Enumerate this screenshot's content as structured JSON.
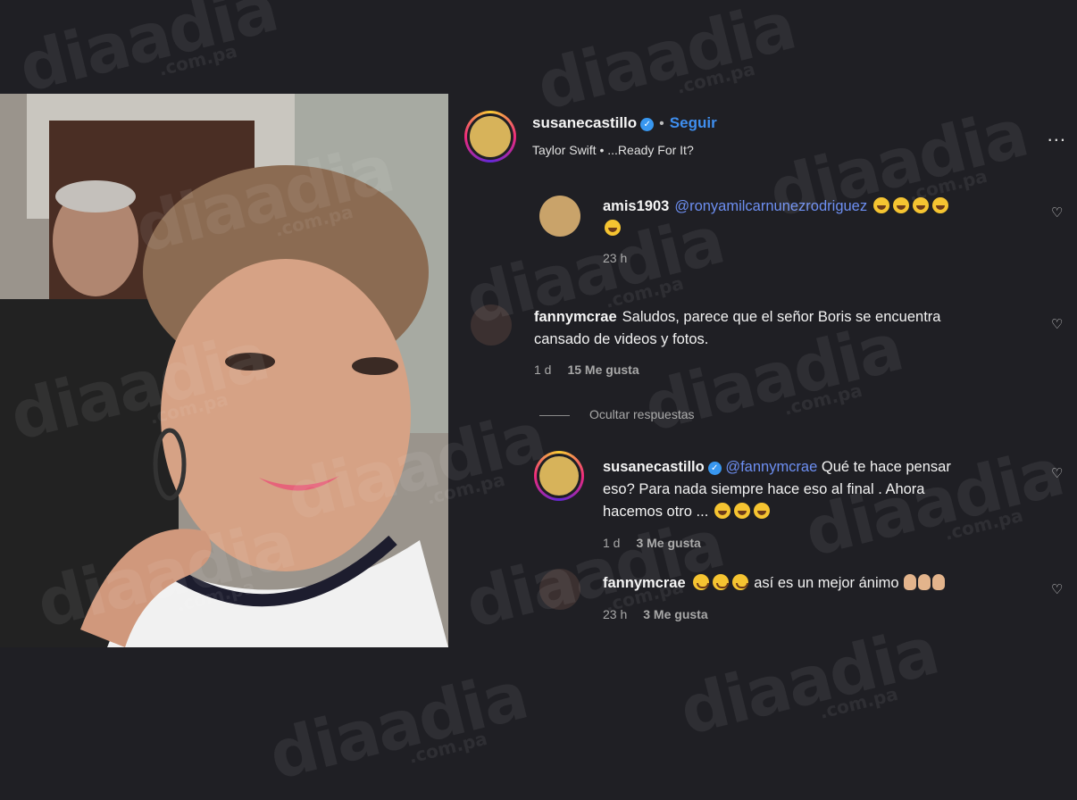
{
  "post": {
    "username": "susanecastillo",
    "verified": "✓",
    "separator": "•",
    "follow_label": "Seguir",
    "song": "Taylor Swift • ...Ready For It?",
    "more_label": "..."
  },
  "comments": [
    {
      "user": "amis1903",
      "mention": "@ronyamilcarnunezrodriguez",
      "text": "",
      "time": "23 h",
      "likes": ""
    },
    {
      "user": "fannymcrae",
      "mention": "",
      "text_line1": "Saludos, parece que el señor Boris se encuentra",
      "text_line2": "cansado de videos y fotos.",
      "time": "1 d",
      "likes": "15 Me gusta"
    }
  ],
  "hide_replies_label": "Ocultar respuestas",
  "replies": [
    {
      "user": "susanecastillo",
      "verified": "✓",
      "mention": "@fannymcrae",
      "text_line1": "Qué te hace pensar",
      "text_line2": "eso? Para nada siempre hace eso al final . Ahora",
      "text_line3": "hacemos otro ...",
      "time": "1 d",
      "likes": "3 Me gusta"
    },
    {
      "user": "fannymcrae",
      "text": "así es un mejor ánimo",
      "time": "23 h",
      "likes": "3 Me gusta"
    }
  ],
  "watermark": {
    "brand": "diaadia",
    "domain": ".com.pa"
  },
  "icons": {
    "heart": "♡"
  }
}
